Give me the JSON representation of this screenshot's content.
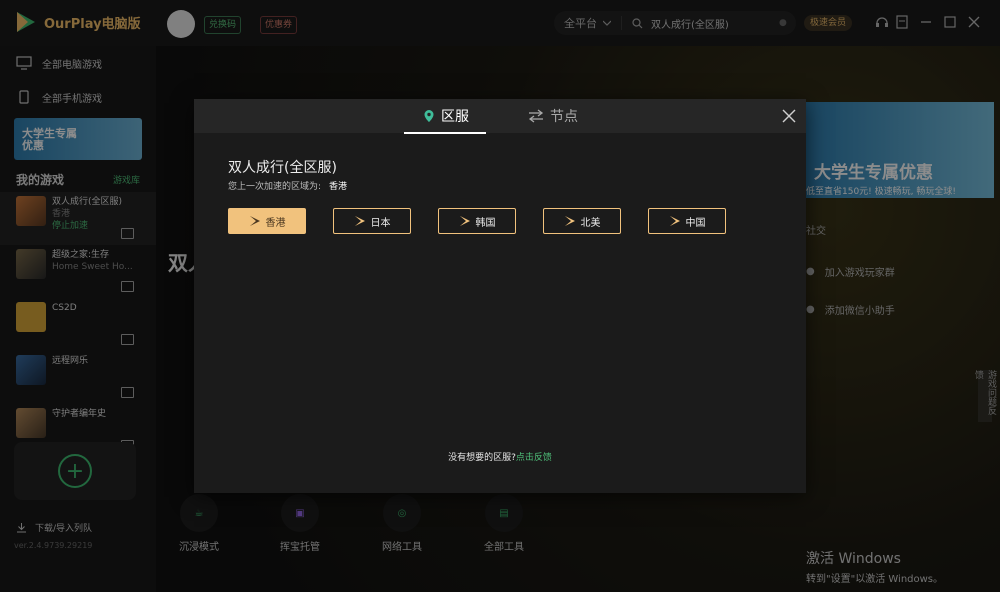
{
  "app": {
    "name": "OurPlay电脑版"
  },
  "header": {
    "redeem_label": "兑换码",
    "coupon_label": "优惠券",
    "platform_label": "全平台",
    "search_value": "双人成行(全区服)",
    "vip_label": "极速会员"
  },
  "sidebar": {
    "nav": [
      {
        "label": "全部电脑游戏",
        "icon": "monitor-icon"
      },
      {
        "label": "全部手机游戏",
        "icon": "phone-icon"
      }
    ],
    "banner_text": "大学生专属优惠",
    "my_games_label": "我的游戏",
    "manage_label": "游戏库",
    "games": [
      {
        "title": "双人成行(全区服)",
        "sub": "香港",
        "link": "停止加速"
      },
      {
        "title": "超级之家:生存",
        "sub": "Home Sweet Ho..."
      },
      {
        "title": "CS2D",
        "sub": ""
      },
      {
        "title": "远程网乐",
        "sub": ""
      },
      {
        "title": "守护者编年史",
        "sub": ""
      }
    ],
    "download_label": "下载/导入列队",
    "version": "ver.2.4.9739.29219"
  },
  "background": {
    "game_title_partial": "双人",
    "banner_title": "大学生专属优惠",
    "banner_sub": "低至直省150元! 极速畅玩, 畅玩全球!",
    "social_title": "社交",
    "join_group": "加入游戏玩家群",
    "add_wechat": "添加微信小助手",
    "side_tab": "游戏问题反馈",
    "tools": [
      "沉浸模式",
      "挥宝托管",
      "网络工具",
      "全部工具"
    ],
    "activate_title": "激活 Windows",
    "activate_sub": "转到\"设置\"以激活 Windows。"
  },
  "modal": {
    "tabs": [
      {
        "label": "区服",
        "icon": "location-pin-icon",
        "active": true
      },
      {
        "label": "节点",
        "icon": "swap-arrows-icon",
        "active": false
      }
    ],
    "game_title": "双人成行(全区服)",
    "last_region_prefix": "您上一次加速的区域为:",
    "last_region_value": "香港",
    "regions": [
      {
        "label": "香港",
        "selected": true
      },
      {
        "label": "日本",
        "selected": false
      },
      {
        "label": "韩国",
        "selected": false
      },
      {
        "label": "北美",
        "selected": false
      },
      {
        "label": "中国",
        "selected": false
      }
    ],
    "feedback_text": "没有想要的区服?",
    "feedback_link": "点击反馈"
  },
  "colors": {
    "accent_gold": "#f1c27d",
    "accent_green": "#4fbf79",
    "modal_bg": "#1b1b1b",
    "app_bg": "#141414"
  }
}
